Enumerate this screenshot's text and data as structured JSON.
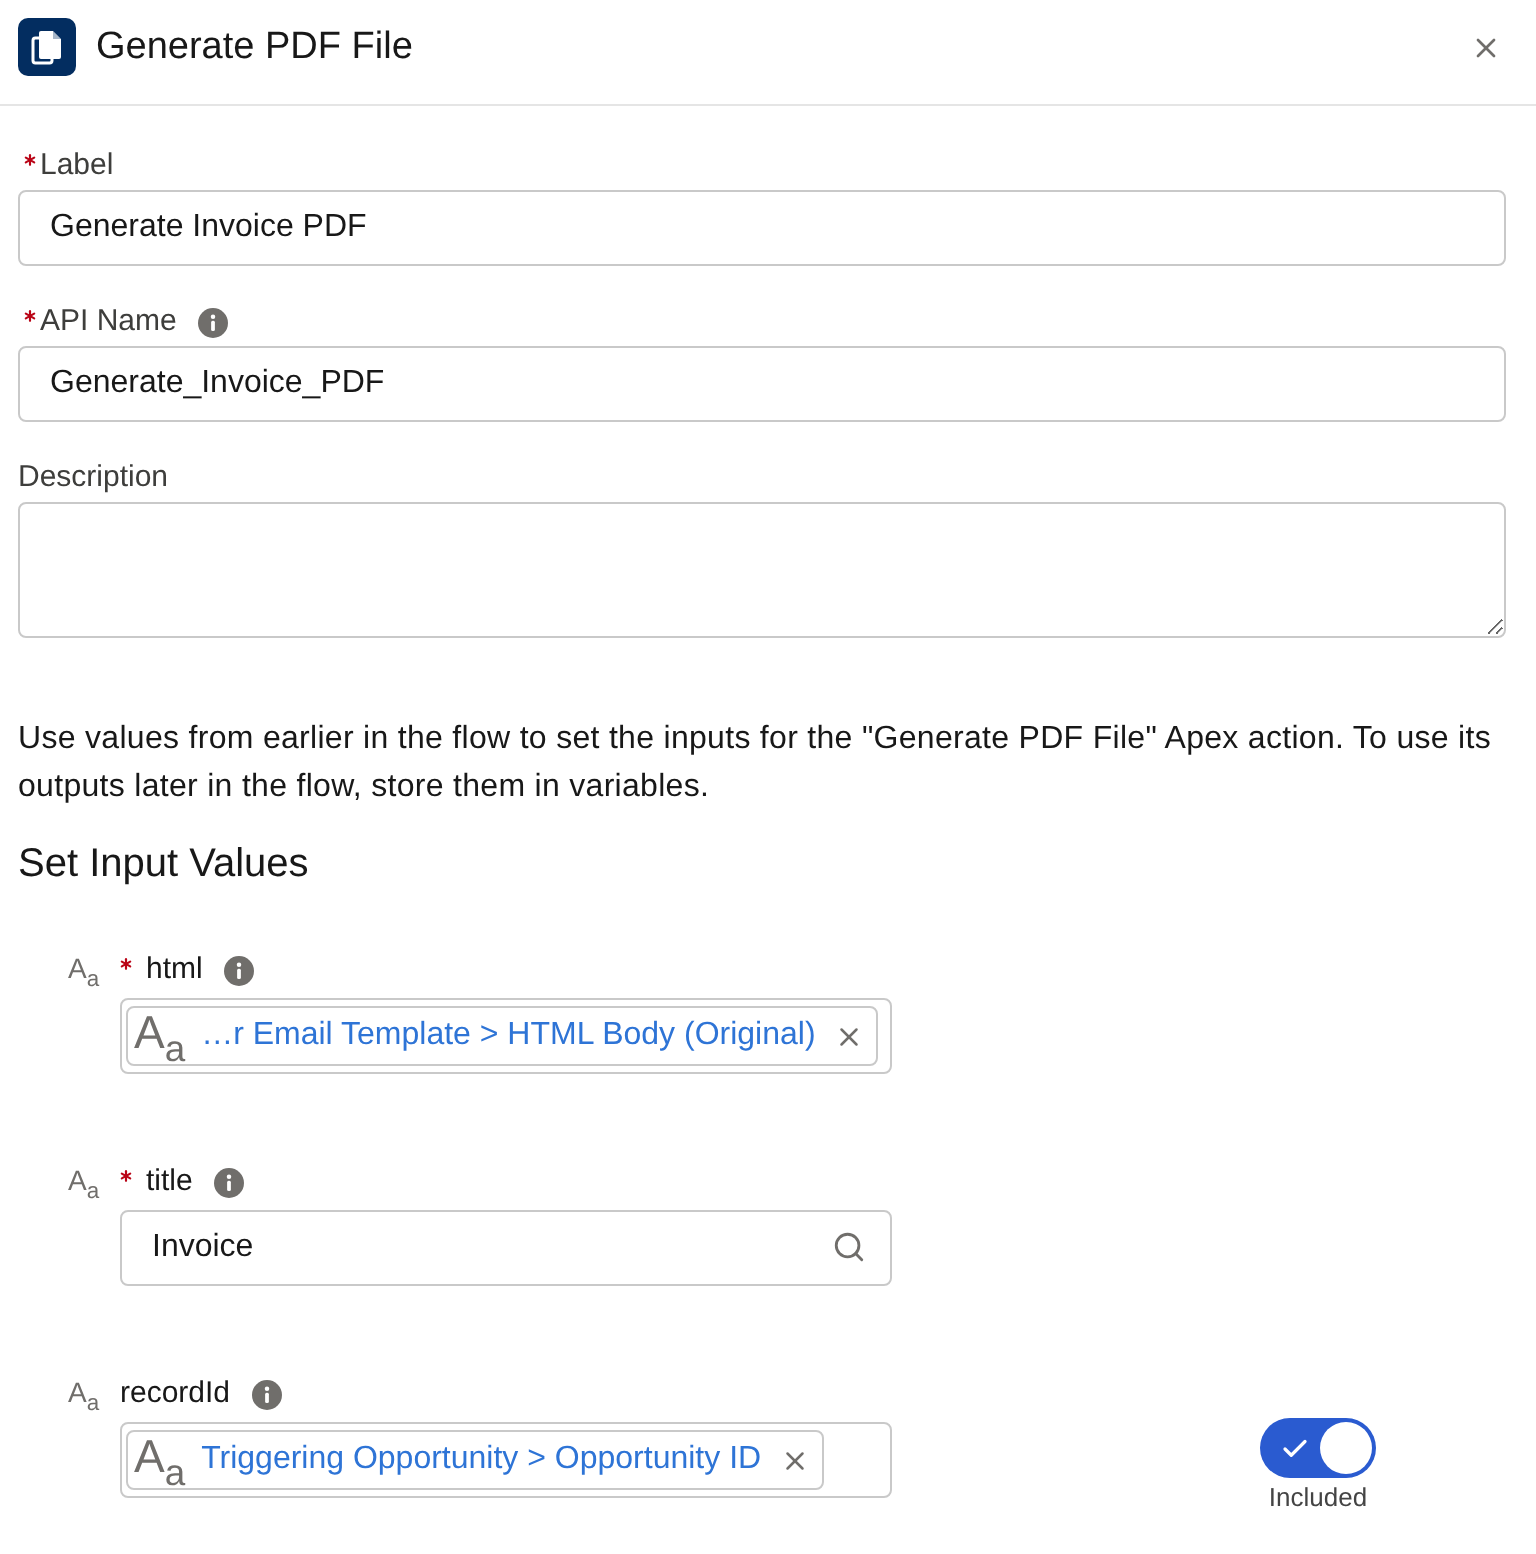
{
  "dialog": {
    "title": "Generate PDF File"
  },
  "fields": [
    {
      "kind": "input",
      "label": "Label",
      "required": true,
      "info": false,
      "value": "Generate Invoice PDF"
    },
    {
      "kind": "input",
      "label": "API Name",
      "required": true,
      "info": true,
      "value": "Generate_Invoice_PDF"
    },
    {
      "kind": "textarea",
      "label": "Description",
      "required": false,
      "info": false
    }
  ],
  "intro": "Use values from earlier in the flow to set the inputs for the \"Generate PDF File\" Apex action. To use its outputs later in the flow, store them in variables.",
  "section_title": "Set Input Values",
  "inputs": [
    {
      "type_glyph": "A$_{a}$",
      "name": "html",
      "required": true,
      "info": true,
      "value": {
        "kind": "resource",
        "type_glyph": "A$_{a}$",
        "text": "…r Email Template > HTML Body (Original)"
      }
    },
    {
      "type_glyph": "A$_{a}$",
      "name": "title",
      "required": true,
      "info": true,
      "value": {
        "kind": "text",
        "text": "Invoice"
      }
    },
    {
      "type_glyph": "A$_{a}$",
      "name": "recordId",
      "required": false,
      "info": true,
      "value": {
        "kind": "resource",
        "type_glyph": "A$_{a}$",
        "text": "Triggering Opportunity > Opportunity ID"
      },
      "toggle": {
        "on": true,
        "label": "Included"
      }
    }
  ]
}
